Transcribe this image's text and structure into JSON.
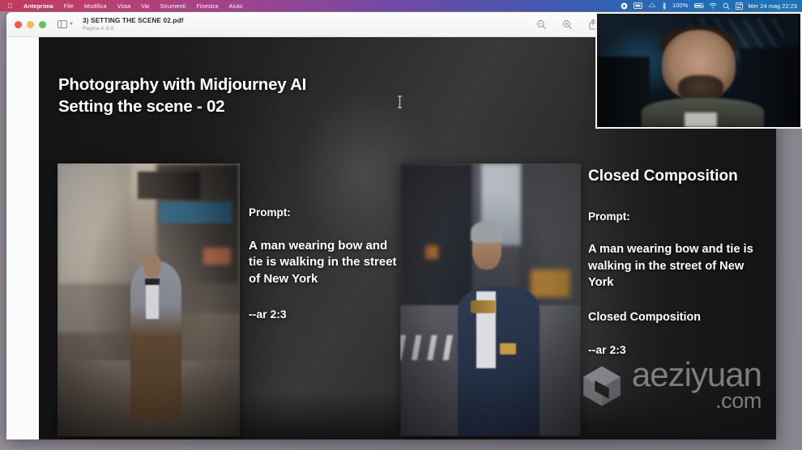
{
  "menubar": {
    "apple_glyph": "●",
    "items": [
      "Anteprima",
      "File",
      "Modifica",
      "Vista",
      "Vai",
      "Strumenti",
      "Finestra",
      "Aiuto"
    ],
    "status": {
      "record_icon": "record-icon",
      "display_icon": "display-icon",
      "control_center_icon": "control-center-icon",
      "bluetooth_glyph": "ᛞ",
      "battery_percent": "100%",
      "wifi_glyph": "◠",
      "search_glyph": "⚲",
      "siri_icon": "siri-icon",
      "clock": "Mer 24 mag  22:23"
    }
  },
  "window": {
    "traffic": {
      "close": "close-button",
      "minimize": "minimize-button",
      "zoom": "zoom-button"
    },
    "sidebar_toggle": "sidebar-toggle",
    "document_title": "3) SETTING THE SCENE 02.pdf",
    "page_indicator": "Pagina 4 di 8",
    "toolbar": {
      "zoom_out": "zoom-out-icon",
      "zoom_in": "zoom-in-icon",
      "share": "share-icon"
    }
  },
  "slide": {
    "title_line1": "Photography with Midjourney AI",
    "title_line2": "Setting the scene - 02",
    "middle_column": {
      "prompt_label": "Prompt:",
      "prompt_text": "A man wearing bow and tie is walking in the street of New York",
      "aspect_ratio": "--ar 2:3"
    },
    "right_column": {
      "heading": "Closed Composition",
      "prompt_label": "Prompt:",
      "prompt_text": "A man wearing bow and tie is walking in the street of New York",
      "modifier": "Closed Composition",
      "aspect_ratio": "--ar 2:3"
    },
    "images": {
      "left_photo": "open-composition-street-photo",
      "middle_photo": "closed-composition-street-photo",
      "background_photo": "blurred-portrait-background"
    }
  },
  "watermark": {
    "name": "aeziyuan",
    "domain": ".com",
    "logo": "aeziyuan-cube-logo"
  },
  "webcam": {
    "label": "presenter-webcam-overlay"
  },
  "colors": {
    "menubar_left": "#c23a5c",
    "menubar_right": "#1b74bb",
    "slide_bg": "#191919",
    "desktop": "#8b8791",
    "window_chrome": "#f7f7f7",
    "watermark_text": "#b9bbc0"
  }
}
